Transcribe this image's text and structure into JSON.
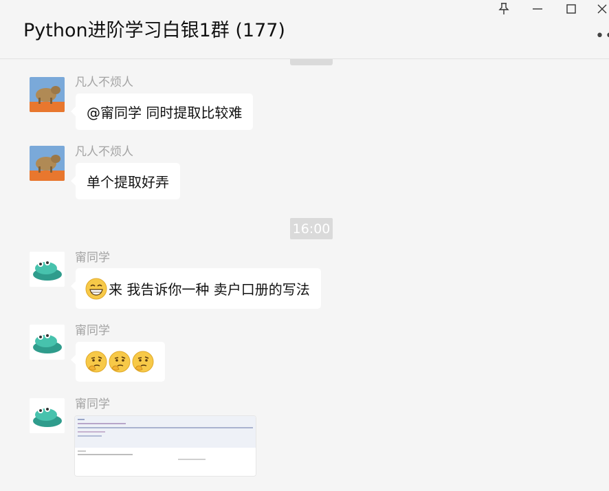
{
  "window": {
    "title": "Python进阶学习白银1群 (177)"
  },
  "messages": [
    {
      "sender": "凡人不烦人",
      "text": "@甯同学 同时提取比较难"
    },
    {
      "sender": "凡人不烦人",
      "text": "单个提取好弄"
    },
    {
      "sender": "甯同学",
      "text": "来 我告诉你一种 卖户口册的写法"
    },
    {
      "sender": "甯同学"
    },
    {
      "sender": "甯同学"
    }
  ],
  "timestamp": "16:00",
  "icons": [
    "pin-icon",
    "minimize-icon",
    "maximize-icon",
    "close-icon",
    "more-icon",
    "grin-emoji",
    "thinking-emoji"
  ]
}
